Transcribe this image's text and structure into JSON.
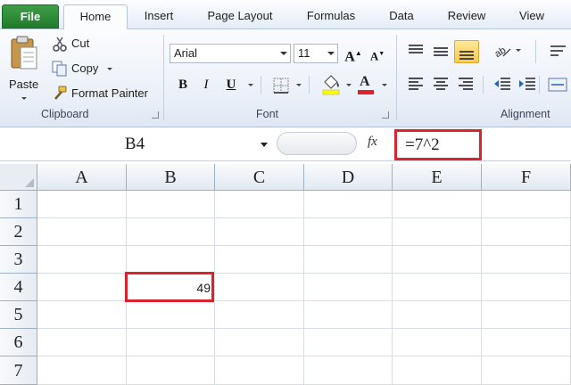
{
  "tabs": [
    "File",
    "Home",
    "Insert",
    "Page Layout",
    "Formulas",
    "Data",
    "Review",
    "View"
  ],
  "clipboard": {
    "paste_label": "Paste",
    "cut_label": "Cut",
    "copy_label": "Copy",
    "format_painter_label": "Format Painter",
    "group_label": "Clipboard"
  },
  "font": {
    "font_name": "Arial",
    "font_size": "11",
    "group_label": "Font",
    "bold_label": "B",
    "italic_label": "I",
    "underline_label": "U",
    "font_color_letter": "A",
    "grow_letter": "A",
    "shrink_letter": "A"
  },
  "alignment": {
    "group_label": "Alignment"
  },
  "formula_bar": {
    "name_box": "B4",
    "fx_label": "fx",
    "formula": "=7^2"
  },
  "grid": {
    "columns": [
      "A",
      "B",
      "C",
      "D",
      "E",
      "F"
    ],
    "rows": [
      "1",
      "2",
      "3",
      "4",
      "5",
      "6",
      "7"
    ],
    "b4_value": "49"
  },
  "colors": {
    "highlight": "#d9232e",
    "file_tab": "#2e8b3a",
    "fill_yellow": "#ffff00",
    "font_red": "#e0202a"
  }
}
